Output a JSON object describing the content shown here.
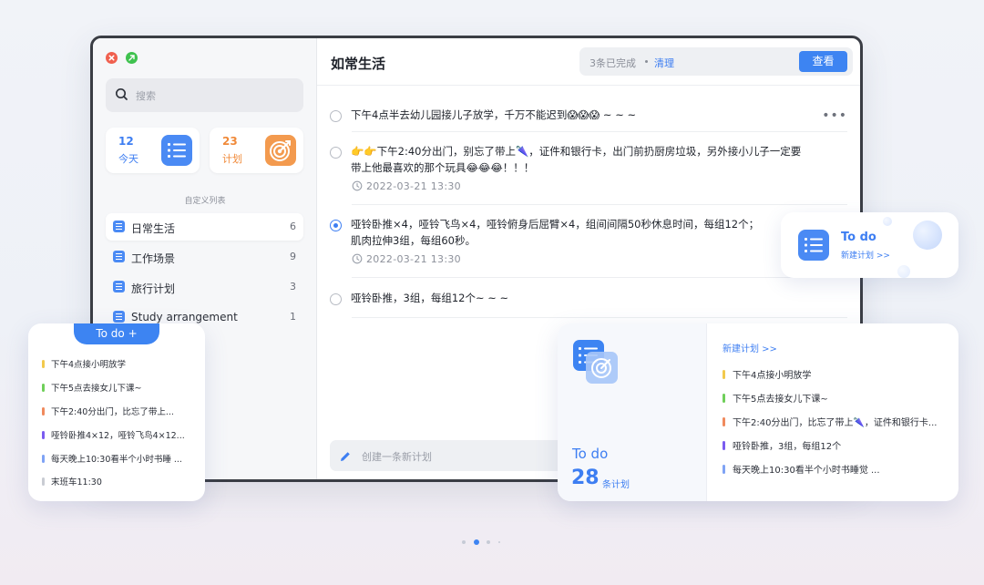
{
  "sidebar": {
    "search_placeholder": "搜索",
    "cards": [
      {
        "count": "12",
        "label": "今天",
        "icon": "list-icon"
      },
      {
        "count": "23",
        "label": "计划",
        "icon": "target-icon"
      }
    ],
    "section_label": "自定义列表",
    "lists": [
      {
        "label": "日常生活",
        "count": "6",
        "active": true
      },
      {
        "label": "工作场景",
        "count": "9"
      },
      {
        "label": "旅行计划",
        "count": "3"
      },
      {
        "label": "Study arrangement",
        "count": "1"
      }
    ]
  },
  "main": {
    "title": "如常生活",
    "done_text": "3条已完成",
    "clear_label": "清理",
    "view_label": "查看",
    "tasks": [
      {
        "line1": "下午4点半去幼儿园接儿子放学，千万不能迟到😱😱😱 ~ ~ ~",
        "more": "•••"
      },
      {
        "line1": "👉👉下午2:40分出门，别忘了带上🌂，证件和银行卡，出门前扔厨房垃圾，另外接小儿子一定要",
        "line2": "带上他最喜欢的那个玩具😂😂😂！！！",
        "date": "2022-03-21   13:30"
      },
      {
        "line1": "哑铃卧推×4，哑铃飞鸟×4，哑铃俯身后屈臂×4，组间间隔50秒休息时间，每组12个；",
        "line2": "肌肉拉伸3组，每组60秒。",
        "date": "2022-03-21   13:30",
        "checked": true
      },
      {
        "line1": "哑铃卧推，3组，每组12个~ ~ ~"
      }
    ],
    "composer_placeholder": "创建一条新计划"
  },
  "widget_small": {
    "title": "To do",
    "subtitle": "新建计划 >>"
  },
  "widget_left": {
    "tab_label": "To do  +",
    "items": [
      {
        "text": "下午4点接小明放学",
        "color": "#f2c94c"
      },
      {
        "text": "下午5点去接女儿下课~",
        "color": "#6fcf5a"
      },
      {
        "text": "下午2:40分出门，比忘了带上...",
        "color": "#f08a5d"
      },
      {
        "text": "哑铃卧推4×12，哑铃飞鸟4×12...",
        "color": "#7b5cf0"
      },
      {
        "text": "每天晚上10:30看半个小时书睡 ...",
        "color": "#7fa3f5"
      },
      {
        "text": "末班车11:30",
        "color": "#c9ccd3"
      }
    ]
  },
  "widget_right": {
    "title": "To do",
    "count": "28",
    "unit": "条计划",
    "link": "新建计划  >>",
    "items": [
      {
        "text": "下午4点接小明放学",
        "color": "#f2c94c"
      },
      {
        "text": "下午5点去接女儿下课~",
        "color": "#6fcf5a"
      },
      {
        "text": "下午2:40分出门，比忘了带上🌂，证件和银行卡...",
        "color": "#f08a5d"
      },
      {
        "text": "哑铃卧推，3组，每组12个",
        "color": "#7b5cf0"
      },
      {
        "text": "每天晚上10:30看半个小时书睡觉 ...",
        "color": "#7fa3f5"
      }
    ]
  },
  "colors": {
    "accent": "#3d84f2",
    "orange": "#f39a4e",
    "close": "#f0604f",
    "max": "#3fc24f"
  }
}
